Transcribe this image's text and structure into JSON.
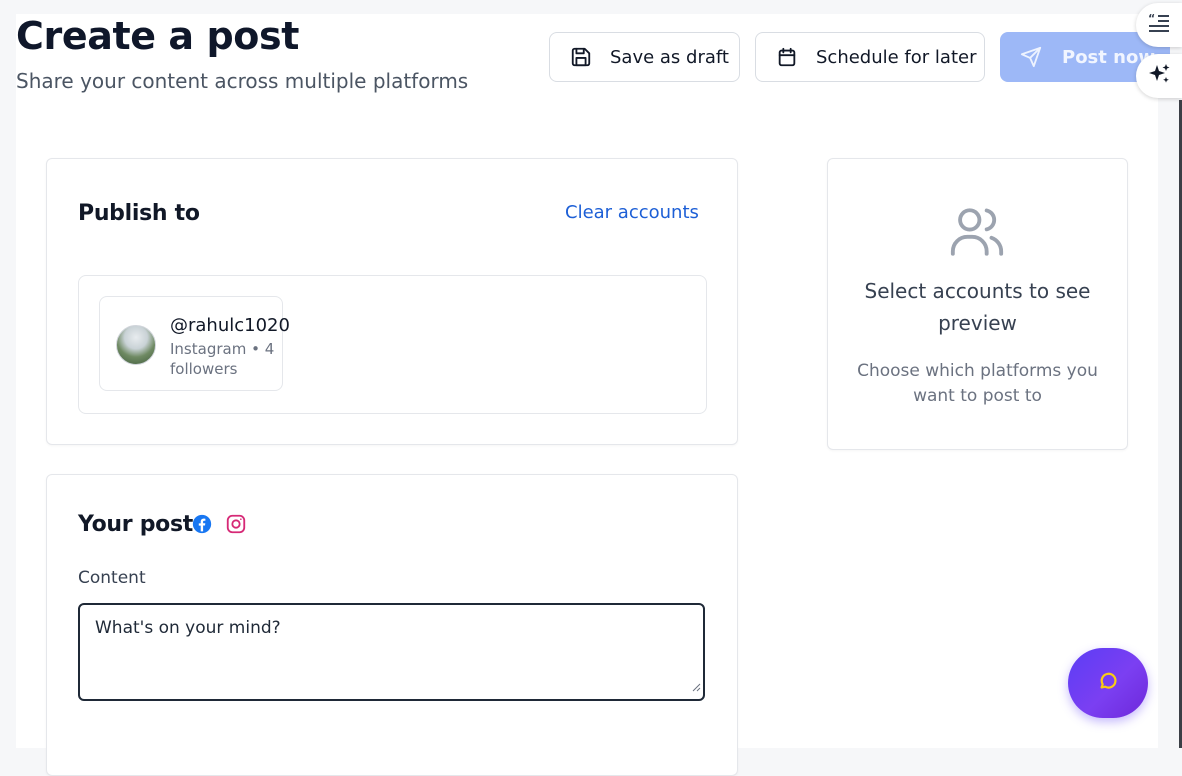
{
  "header": {
    "title": "Create a post",
    "subtitle": "Share your content across multiple platforms",
    "save_draft_label": "Save as draft",
    "schedule_label": "Schedule for later",
    "post_now_label": "Post now"
  },
  "publish": {
    "heading": "Publish to",
    "clear_label": "Clear accounts",
    "accounts": [
      {
        "handle": "@rahulc1020",
        "meta": "Instagram • 4 followers"
      }
    ]
  },
  "post": {
    "heading": "Your post",
    "platforms": [
      "facebook-icon",
      "instagram-icon"
    ],
    "content_label": "Content",
    "content_placeholder": "What's on your mind?"
  },
  "preview": {
    "title": "Select accounts to see preview",
    "subtitle": "Choose which platforms you want to post to"
  },
  "colors": {
    "accent": "#1d5fd6",
    "post_button": "#9db8f7",
    "chat_fab": "#6d3ff2",
    "instagram": "#d62976",
    "facebook": "#1877f2"
  }
}
